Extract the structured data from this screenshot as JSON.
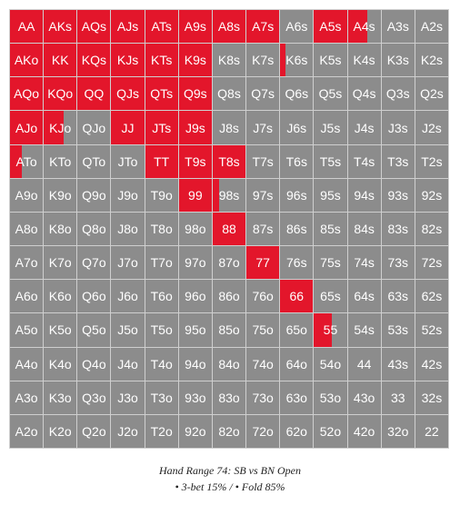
{
  "colors": {
    "three_bet": "#e3162b",
    "fold": "#8c8c8c"
  },
  "caption": {
    "title": "Hand Range 74: SB vs BN Open",
    "legend": "• 3-bet 15% / • Fold 85%"
  },
  "rows": [
    [
      {
        "label": "AA",
        "raise": 1
      },
      {
        "label": "AKs",
        "raise": 1
      },
      {
        "label": "AQs",
        "raise": 1
      },
      {
        "label": "AJs",
        "raise": 1
      },
      {
        "label": "ATs",
        "raise": 1
      },
      {
        "label": "A9s",
        "raise": 1
      },
      {
        "label": "A8s",
        "raise": 1
      },
      {
        "label": "A7s",
        "raise": 1
      },
      {
        "label": "A6s",
        "raise": 0
      },
      {
        "label": "A5s",
        "raise": 1
      },
      {
        "label": "A4s",
        "raise": 0.6
      },
      {
        "label": "A3s",
        "raise": 0
      },
      {
        "label": "A2s",
        "raise": 0
      }
    ],
    [
      {
        "label": "AKo",
        "raise": 1
      },
      {
        "label": "KK",
        "raise": 1
      },
      {
        "label": "KQs",
        "raise": 1
      },
      {
        "label": "KJs",
        "raise": 1
      },
      {
        "label": "KTs",
        "raise": 1
      },
      {
        "label": "K9s",
        "raise": 1
      },
      {
        "label": "K8s",
        "raise": 0
      },
      {
        "label": "K7s",
        "raise": 0
      },
      {
        "label": "K6s",
        "raise": 0.15
      },
      {
        "label": "K5s",
        "raise": 0
      },
      {
        "label": "K4s",
        "raise": 0
      },
      {
        "label": "K3s",
        "raise": 0
      },
      {
        "label": "K2s",
        "raise": 0
      }
    ],
    [
      {
        "label": "AQo",
        "raise": 1
      },
      {
        "label": "KQo",
        "raise": 1
      },
      {
        "label": "QQ",
        "raise": 1
      },
      {
        "label": "QJs",
        "raise": 1
      },
      {
        "label": "QTs",
        "raise": 1
      },
      {
        "label": "Q9s",
        "raise": 1
      },
      {
        "label": "Q8s",
        "raise": 0
      },
      {
        "label": "Q7s",
        "raise": 0
      },
      {
        "label": "Q6s",
        "raise": 0
      },
      {
        "label": "Q5s",
        "raise": 0
      },
      {
        "label": "Q4s",
        "raise": 0
      },
      {
        "label": "Q3s",
        "raise": 0
      },
      {
        "label": "Q2s",
        "raise": 0
      }
    ],
    [
      {
        "label": "AJo",
        "raise": 1
      },
      {
        "label": "KJo",
        "raise": 0.6
      },
      {
        "label": "QJo",
        "raise": 0
      },
      {
        "label": "JJ",
        "raise": 1
      },
      {
        "label": "JTs",
        "raise": 1
      },
      {
        "label": "J9s",
        "raise": 1
      },
      {
        "label": "J8s",
        "raise": 0
      },
      {
        "label": "J7s",
        "raise": 0
      },
      {
        "label": "J6s",
        "raise": 0
      },
      {
        "label": "J5s",
        "raise": 0
      },
      {
        "label": "J4s",
        "raise": 0
      },
      {
        "label": "J3s",
        "raise": 0
      },
      {
        "label": "J2s",
        "raise": 0
      }
    ],
    [
      {
        "label": "ATo",
        "raise": 0.35
      },
      {
        "label": "KTo",
        "raise": 0
      },
      {
        "label": "QTo",
        "raise": 0
      },
      {
        "label": "JTo",
        "raise": 0
      },
      {
        "label": "TT",
        "raise": 1
      },
      {
        "label": "T9s",
        "raise": 1
      },
      {
        "label": "T8s",
        "raise": 1
      },
      {
        "label": "T7s",
        "raise": 0
      },
      {
        "label": "T6s",
        "raise": 0
      },
      {
        "label": "T5s",
        "raise": 0
      },
      {
        "label": "T4s",
        "raise": 0
      },
      {
        "label": "T3s",
        "raise": 0
      },
      {
        "label": "T2s",
        "raise": 0
      }
    ],
    [
      {
        "label": "A9o",
        "raise": 0
      },
      {
        "label": "K9o",
        "raise": 0
      },
      {
        "label": "Q9o",
        "raise": 0
      },
      {
        "label": "J9o",
        "raise": 0
      },
      {
        "label": "T9o",
        "raise": 0
      },
      {
        "label": "99",
        "raise": 1
      },
      {
        "label": "98s",
        "raise": 0.2
      },
      {
        "label": "97s",
        "raise": 0
      },
      {
        "label": "96s",
        "raise": 0
      },
      {
        "label": "95s",
        "raise": 0
      },
      {
        "label": "94s",
        "raise": 0
      },
      {
        "label": "93s",
        "raise": 0
      },
      {
        "label": "92s",
        "raise": 0
      }
    ],
    [
      {
        "label": "A8o",
        "raise": 0
      },
      {
        "label": "K8o",
        "raise": 0
      },
      {
        "label": "Q8o",
        "raise": 0
      },
      {
        "label": "J8o",
        "raise": 0
      },
      {
        "label": "T8o",
        "raise": 0
      },
      {
        "label": "98o",
        "raise": 0
      },
      {
        "label": "88",
        "raise": 1
      },
      {
        "label": "87s",
        "raise": 0
      },
      {
        "label": "86s",
        "raise": 0
      },
      {
        "label": "85s",
        "raise": 0
      },
      {
        "label": "84s",
        "raise": 0
      },
      {
        "label": "83s",
        "raise": 0
      },
      {
        "label": "82s",
        "raise": 0
      }
    ],
    [
      {
        "label": "A7o",
        "raise": 0
      },
      {
        "label": "K7o",
        "raise": 0
      },
      {
        "label": "Q7o",
        "raise": 0
      },
      {
        "label": "J7o",
        "raise": 0
      },
      {
        "label": "T7o",
        "raise": 0
      },
      {
        "label": "97o",
        "raise": 0
      },
      {
        "label": "87o",
        "raise": 0
      },
      {
        "label": "77",
        "raise": 1
      },
      {
        "label": "76s",
        "raise": 0
      },
      {
        "label": "75s",
        "raise": 0
      },
      {
        "label": "74s",
        "raise": 0
      },
      {
        "label": "73s",
        "raise": 0
      },
      {
        "label": "72s",
        "raise": 0
      }
    ],
    [
      {
        "label": "A6o",
        "raise": 0
      },
      {
        "label": "K6o",
        "raise": 0
      },
      {
        "label": "Q6o",
        "raise": 0
      },
      {
        "label": "J6o",
        "raise": 0
      },
      {
        "label": "T6o",
        "raise": 0
      },
      {
        "label": "96o",
        "raise": 0
      },
      {
        "label": "86o",
        "raise": 0
      },
      {
        "label": "76o",
        "raise": 0
      },
      {
        "label": "66",
        "raise": 1
      },
      {
        "label": "65s",
        "raise": 0
      },
      {
        "label": "64s",
        "raise": 0
      },
      {
        "label": "63s",
        "raise": 0
      },
      {
        "label": "62s",
        "raise": 0
      }
    ],
    [
      {
        "label": "A5o",
        "raise": 0
      },
      {
        "label": "K5o",
        "raise": 0
      },
      {
        "label": "Q5o",
        "raise": 0
      },
      {
        "label": "J5o",
        "raise": 0
      },
      {
        "label": "T5o",
        "raise": 0
      },
      {
        "label": "95o",
        "raise": 0
      },
      {
        "label": "85o",
        "raise": 0
      },
      {
        "label": "75o",
        "raise": 0
      },
      {
        "label": "65o",
        "raise": 0
      },
      {
        "label": "55",
        "raise": 0.55
      },
      {
        "label": "54s",
        "raise": 0
      },
      {
        "label": "53s",
        "raise": 0
      },
      {
        "label": "52s",
        "raise": 0
      }
    ],
    [
      {
        "label": "A4o",
        "raise": 0
      },
      {
        "label": "K4o",
        "raise": 0
      },
      {
        "label": "Q4o",
        "raise": 0
      },
      {
        "label": "J4o",
        "raise": 0
      },
      {
        "label": "T4o",
        "raise": 0
      },
      {
        "label": "94o",
        "raise": 0
      },
      {
        "label": "84o",
        "raise": 0
      },
      {
        "label": "74o",
        "raise": 0
      },
      {
        "label": "64o",
        "raise": 0
      },
      {
        "label": "54o",
        "raise": 0
      },
      {
        "label": "44",
        "raise": 0
      },
      {
        "label": "43s",
        "raise": 0
      },
      {
        "label": "42s",
        "raise": 0
      }
    ],
    [
      {
        "label": "A3o",
        "raise": 0
      },
      {
        "label": "K3o",
        "raise": 0
      },
      {
        "label": "Q3o",
        "raise": 0
      },
      {
        "label": "J3o",
        "raise": 0
      },
      {
        "label": "T3o",
        "raise": 0
      },
      {
        "label": "93o",
        "raise": 0
      },
      {
        "label": "83o",
        "raise": 0
      },
      {
        "label": "73o",
        "raise": 0
      },
      {
        "label": "63o",
        "raise": 0
      },
      {
        "label": "53o",
        "raise": 0
      },
      {
        "label": "43o",
        "raise": 0
      },
      {
        "label": "33",
        "raise": 0
      },
      {
        "label": "32s",
        "raise": 0
      }
    ],
    [
      {
        "label": "A2o",
        "raise": 0
      },
      {
        "label": "K2o",
        "raise": 0
      },
      {
        "label": "Q2o",
        "raise": 0
      },
      {
        "label": "J2o",
        "raise": 0
      },
      {
        "label": "T2o",
        "raise": 0
      },
      {
        "label": "92o",
        "raise": 0
      },
      {
        "label": "82o",
        "raise": 0
      },
      {
        "label": "72o",
        "raise": 0
      },
      {
        "label": "62o",
        "raise": 0
      },
      {
        "label": "52o",
        "raise": 0
      },
      {
        "label": "42o",
        "raise": 0
      },
      {
        "label": "32o",
        "raise": 0
      },
      {
        "label": "22",
        "raise": 0
      }
    ]
  ]
}
